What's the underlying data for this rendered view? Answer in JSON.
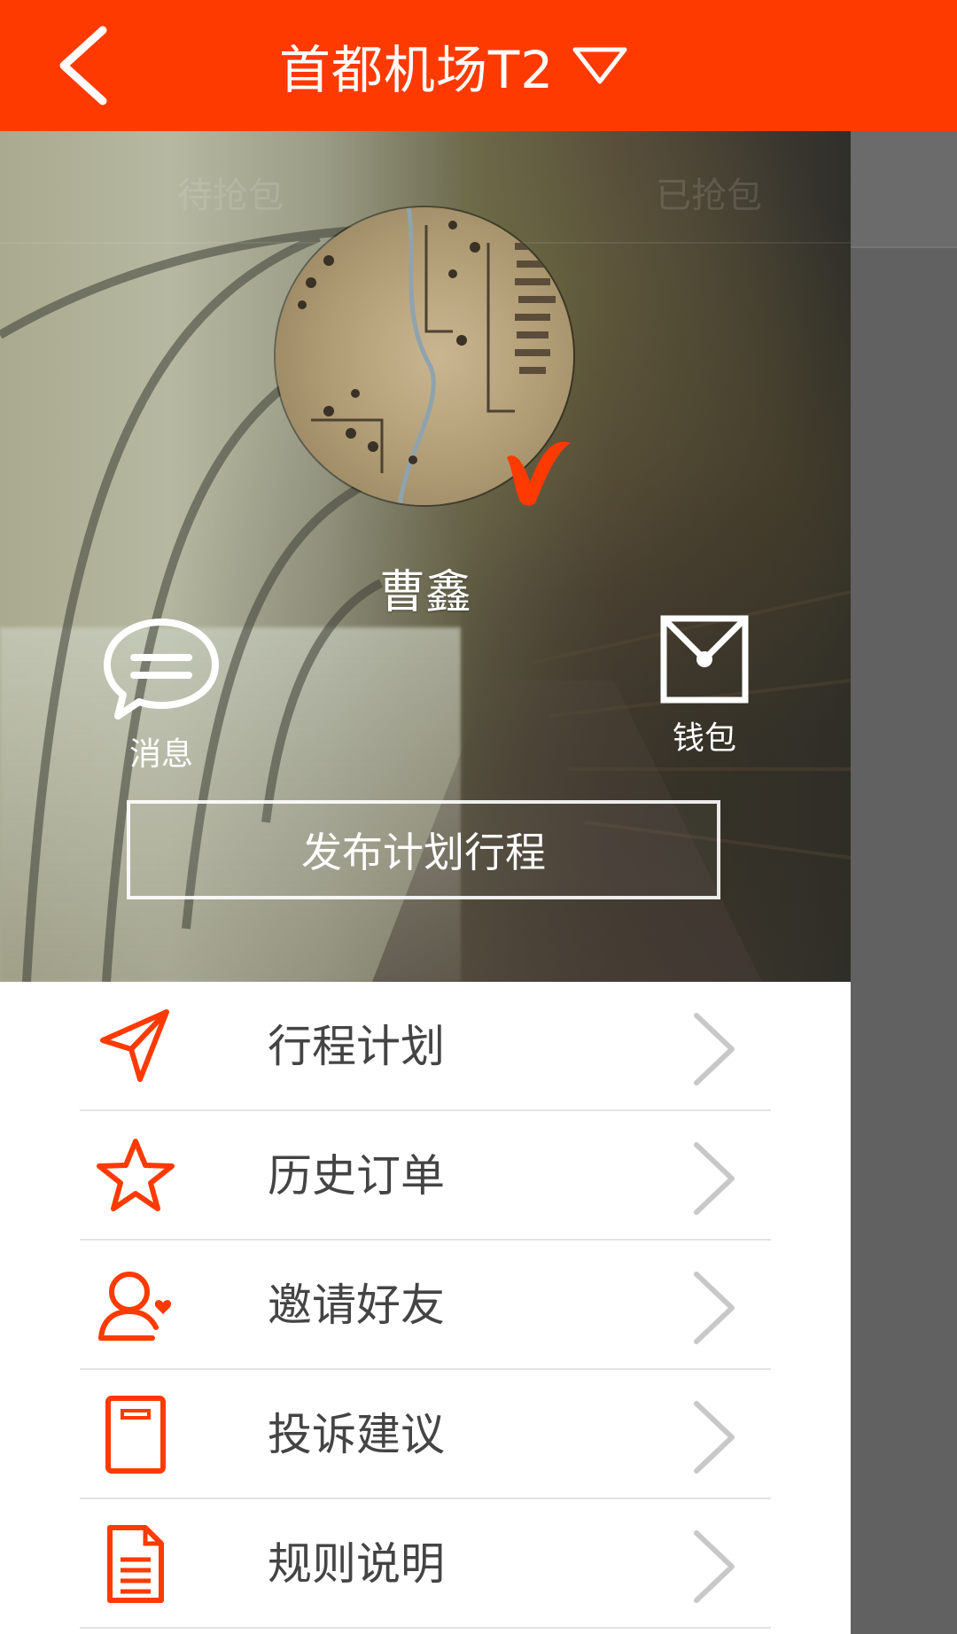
{
  "header": {
    "title": "首都机场T2"
  },
  "profile": {
    "name": "曹鑫",
    "ghost_tabs": [
      "待抢包",
      "已抢包"
    ]
  },
  "quick_actions": {
    "message_label": "消息",
    "wallet_label": "钱包",
    "publish_label": "发布计划行程"
  },
  "menu": {
    "items": [
      {
        "label": "行程计划",
        "icon": "send-icon"
      },
      {
        "label": "历史订单",
        "icon": "star-icon"
      },
      {
        "label": "邀请好友",
        "icon": "add-friend-icon"
      },
      {
        "label": "投诉建议",
        "icon": "feedback-icon"
      },
      {
        "label": "规则说明",
        "icon": "document-icon"
      }
    ]
  },
  "colors": {
    "accent": "#ff3a00",
    "icon": "#ff3a00",
    "menu_text": "#444444",
    "arrow": "#c8c8c8",
    "overlay": "#616161"
  }
}
